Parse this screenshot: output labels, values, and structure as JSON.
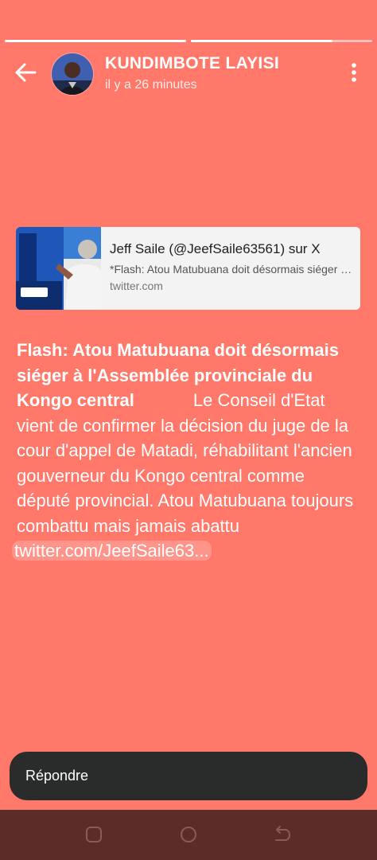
{
  "story": {
    "progress": [
      1.0,
      0.78
    ]
  },
  "header": {
    "name": "KUNDIMBOTE LAYISI",
    "time": "il y a 26 minutes",
    "back_icon": "back-arrow-icon",
    "menu_icon": "more-vert-icon"
  },
  "link_preview": {
    "title": "Jeff Saile (@JeefSaile63561) sur X",
    "description": "*Flash: Atou Matubuana doit désormais siéger à l'Assemblée provinciale du Kongo central",
    "domain": "twitter.com"
  },
  "post": {
    "headline": "Flash: Atou Matubuana doit désormais siéger à l'Assemblée provinciale du Kongo central",
    "body": "Le Conseil d'Etat vient de confirmer la décision du juge de la cour d'appel de Matadi, réhabilitant l'ancien gouverneur du Kongo central comme député provincial. Atou Matubuana toujours combattu mais jamais abattu",
    "link": "twitter.com/JeefSaile63..."
  },
  "reply": {
    "placeholder": "Répondre"
  },
  "nav": {
    "icons": [
      "recents-icon",
      "home-icon",
      "back-icon"
    ]
  },
  "colors": {
    "background": "#ff786a",
    "reply_bar": "#2a2b2b",
    "nav_bar": "#5b2c28",
    "card": "#f3f3f3"
  }
}
